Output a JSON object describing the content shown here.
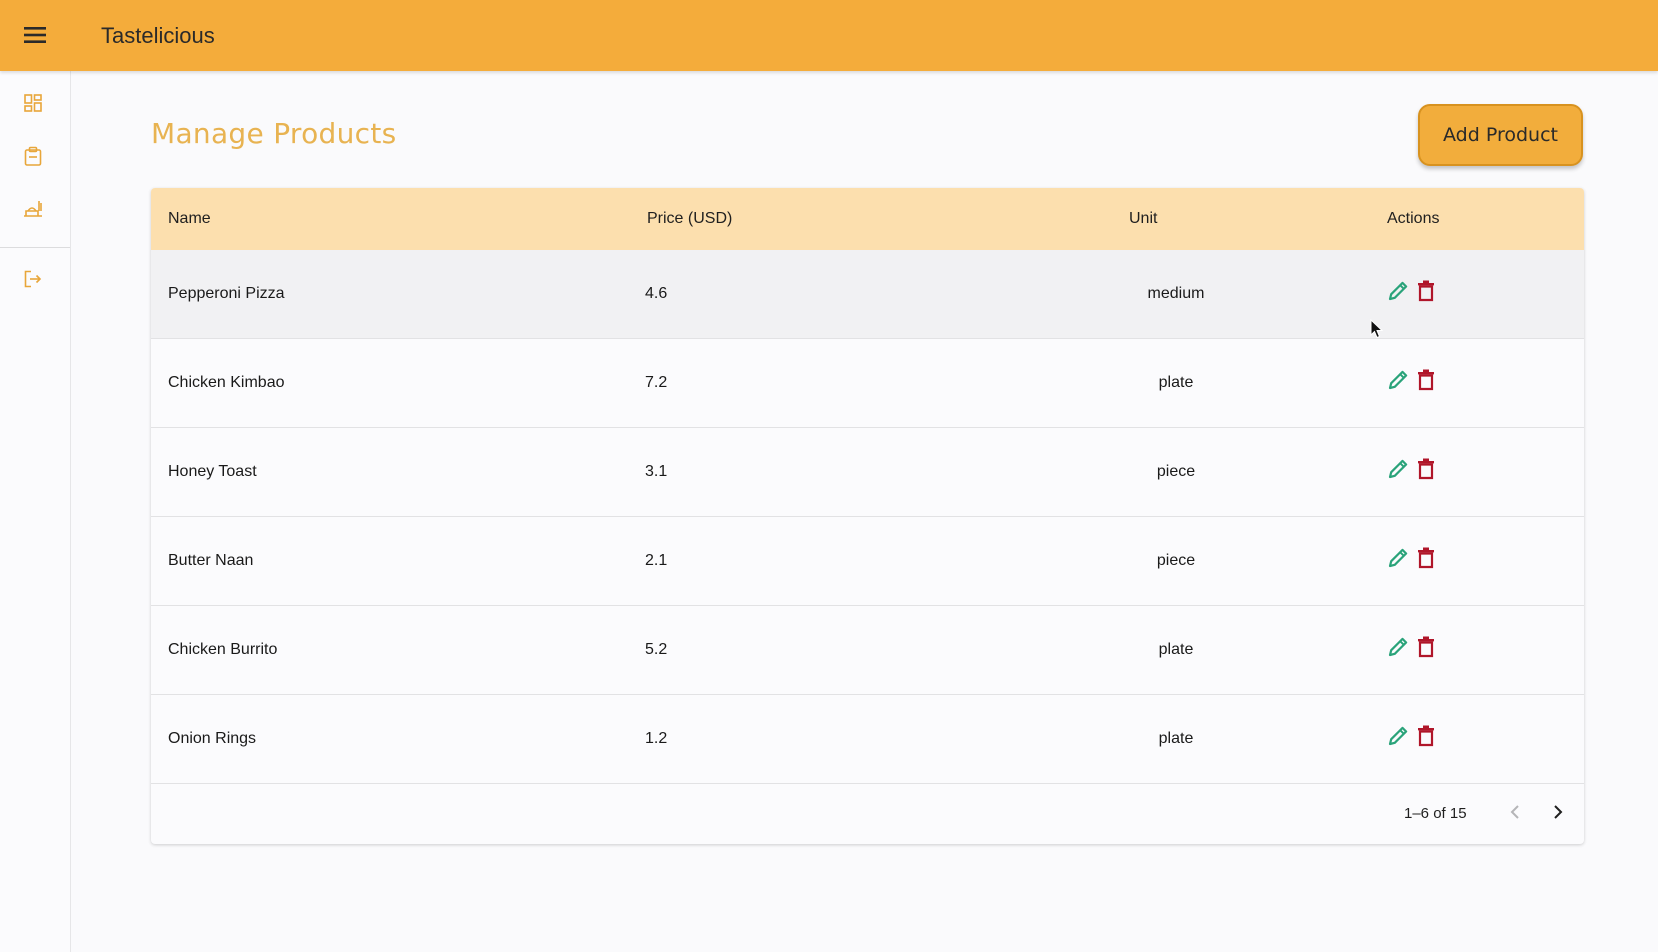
{
  "app": {
    "title": "Tastelicious"
  },
  "icons": {
    "menu": "hamburger-menu-icon",
    "dashboard": "dashboard-grid-icon",
    "orders": "clipboard-icon",
    "products": "food-tray-icon",
    "logout": "logout-icon",
    "edit": "pencil-icon",
    "delete": "trash-icon",
    "prev": "chevron-left-icon",
    "next": "chevron-right-icon"
  },
  "colors": {
    "appbar": "#f4ac3b",
    "accent_title": "#e8b351",
    "table_header": "#fcdfae",
    "edit_icon": "#2aa37a",
    "delete_icon": "#b0162a"
  },
  "main": {
    "title": "Manage Products",
    "add_button": "Add Product"
  },
  "table": {
    "headers": {
      "name": "Name",
      "price": "Price (USD)",
      "unit": "Unit",
      "actions": "Actions"
    },
    "rows": [
      {
        "name": "Pepperoni Pizza",
        "price": "4.6",
        "unit": "medium"
      },
      {
        "name": "Chicken Kimbao",
        "price": "7.2",
        "unit": "plate"
      },
      {
        "name": "Honey Toast",
        "price": "3.1",
        "unit": "piece"
      },
      {
        "name": "Butter Naan",
        "price": "2.1",
        "unit": "piece"
      },
      {
        "name": "Chicken Burrito",
        "price": "5.2",
        "unit": "plate"
      },
      {
        "name": "Onion Rings",
        "price": "1.2",
        "unit": "plate"
      }
    ],
    "pagination": {
      "range": "1–6 of 15"
    }
  }
}
